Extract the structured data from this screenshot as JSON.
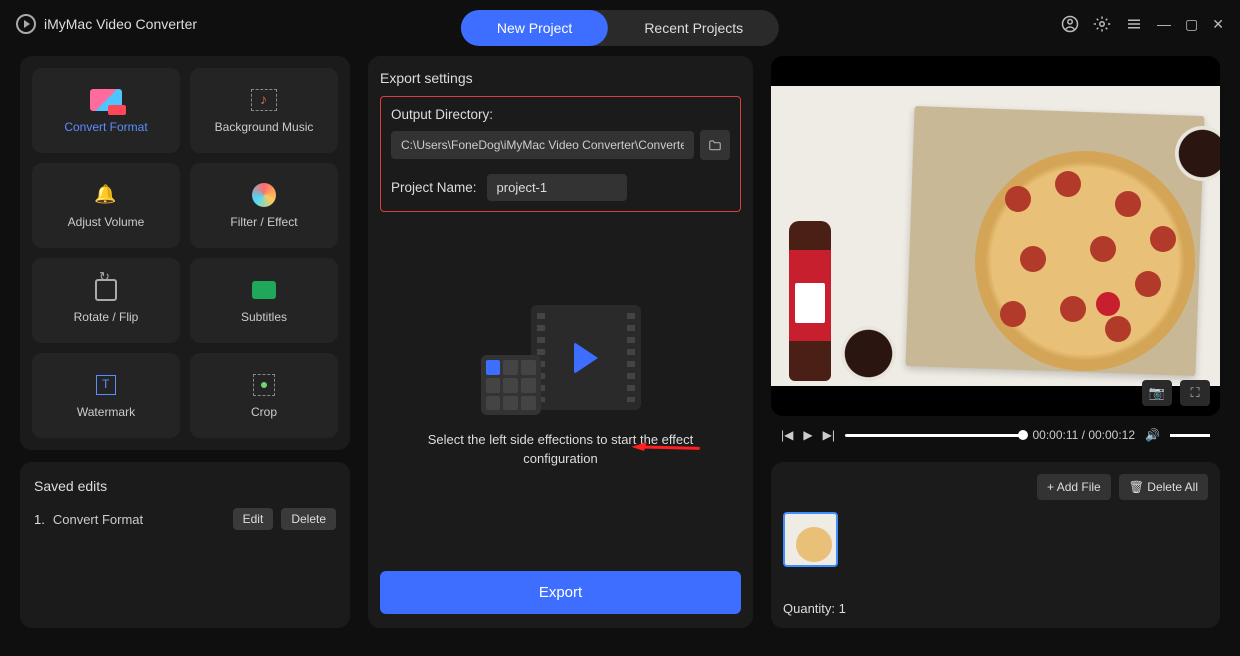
{
  "app": {
    "title": "iMyMac Video Converter"
  },
  "tabs": {
    "new": "New Project",
    "recent": "Recent Projects"
  },
  "sidebar": {
    "effects": [
      {
        "name": "convert-format",
        "label": "Convert Format",
        "icon": "ico-convert",
        "active": true
      },
      {
        "name": "background-music",
        "label": "Background Music",
        "icon": "ico-music"
      },
      {
        "name": "adjust-volume",
        "label": "Adjust Volume",
        "icon": "ico-volume"
      },
      {
        "name": "filter-effect",
        "label": "Filter / Effect",
        "icon": "ico-filter"
      },
      {
        "name": "rotate-flip",
        "label": "Rotate / Flip",
        "icon": "ico-rotate"
      },
      {
        "name": "subtitles",
        "label": "Subtitles",
        "icon": "ico-subtitle"
      },
      {
        "name": "watermark",
        "label": "Watermark",
        "icon": "ico-water"
      },
      {
        "name": "crop",
        "label": "Crop",
        "icon": "ico-crop"
      }
    ],
    "saved": {
      "title": "Saved edits",
      "items": [
        {
          "index": "1.",
          "label": "Convert Format"
        }
      ],
      "edit": "Edit",
      "delete": "Delete"
    }
  },
  "center": {
    "title": "Export settings",
    "outDirLabel": "Output Directory:",
    "outDirValue": "C:\\Users\\FoneDog\\iMyMac Video Converter\\Converted",
    "projNameLabel": "Project Name:",
    "projNameValue": "project-1",
    "hint": "Select the left side effections to start the effect configuration",
    "exportLabel": "Export"
  },
  "preview": {
    "time": "00:00:11 / 00:00:12",
    "addFile": "+ Add File",
    "deleteAll": "🗑 Delete All",
    "qty": "Quantity: 1"
  }
}
